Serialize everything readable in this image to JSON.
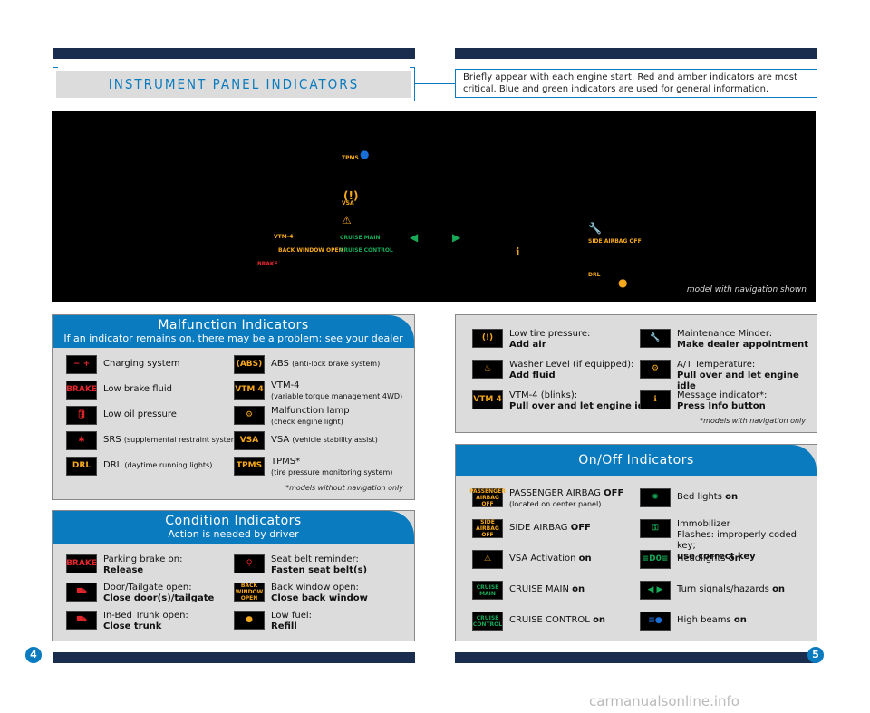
{
  "header": {
    "title": "INSTRUMENT PANEL INDICATORS",
    "note": "Briefly appear with each engine start. Red and amber indicators are most critical. Blue and green indicators are used for general information."
  },
  "dashboard": {
    "caption": "model with navigation shown",
    "labels": [
      "TPMS",
      "VSA",
      "VTM-4",
      "BACK WINDOW OPEN",
      "BRAKE",
      "CRUISE MAIN",
      "CRUISE CONTROL",
      "SIDE AIRBAG OFF",
      "DRL"
    ]
  },
  "colors": {
    "accent": "#0a7bbf",
    "red": "#e3262b",
    "amber": "#f5a81c",
    "green": "#17a957",
    "blue": "#1a6fd6"
  },
  "malfunction": {
    "title": "Malfunction Indicators",
    "subtitle": "If an indicator remains on, there may be a problem; see your dealer",
    "footnote": "*models without navigation only",
    "items": [
      {
        "icon": "battery-icon",
        "glyph": "− +",
        "color": "red",
        "text": "Charging system",
        "note": ""
      },
      {
        "icon": "abs-icon",
        "glyph": "(ABS)",
        "color": "amber",
        "text": "ABS",
        "note": "(anti-lock brake system)"
      },
      {
        "icon": "brake-icon",
        "glyph": "BRAKE",
        "color": "red",
        "text": "Low brake fluid",
        "note": ""
      },
      {
        "icon": "vtm4-icon",
        "glyph": "VTM 4",
        "color": "amber",
        "text": "VTM-4",
        "note": "(variable torque management 4WD)"
      },
      {
        "icon": "oil-can-icon",
        "glyph": "🛢",
        "color": "red",
        "text": "Low oil pressure",
        "note": ""
      },
      {
        "icon": "check-engine-icon",
        "glyph": "⚙",
        "color": "amber",
        "text": "Malfunction lamp",
        "note": "(check engine light)"
      },
      {
        "icon": "srs-airbag-icon",
        "glyph": "✱",
        "color": "red",
        "text": "SRS",
        "note": "(supplemental restraint system)"
      },
      {
        "icon": "vsa-icon",
        "glyph": "VSA",
        "color": "amber",
        "text": "VSA",
        "note": "(vehicle stability assist)"
      },
      {
        "icon": "drl-icon",
        "glyph": "DRL",
        "color": "amber",
        "text": "DRL",
        "note": "(daytime running lights)"
      },
      {
        "icon": "tpms-icon",
        "glyph": "TPMS",
        "color": "amber",
        "text": "TPMS*",
        "note": "(tire pressure monitoring system)"
      }
    ]
  },
  "condition": {
    "title": "Condition Indicators",
    "subtitle": "Action is needed by driver",
    "items": [
      {
        "icon": "parking-brake-icon",
        "glyph": "BRAKE",
        "color": "red",
        "text": "Parking brake on:",
        "action": "Release"
      },
      {
        "icon": "seat-belt-icon",
        "glyph": "⚲",
        "color": "red",
        "text": "Seat belt reminder:",
        "action": "Fasten seat belt(s)"
      },
      {
        "icon": "door-open-icon",
        "glyph": "⛟",
        "color": "red",
        "text": "Door/Tailgate open:",
        "action": "Close door(s)/tailgate"
      },
      {
        "icon": "back-window-icon",
        "glyph": "BACK WINDOW OPEN",
        "color": "amber",
        "text": "Back window open:",
        "action": "Close back window"
      },
      {
        "icon": "trunk-open-icon",
        "glyph": "⛟",
        "color": "red",
        "text": "In-Bed Trunk open:",
        "action": "Close trunk"
      },
      {
        "icon": "low-fuel-icon",
        "glyph": "●",
        "color": "amber",
        "text": "Low fuel:",
        "action": "Refill"
      }
    ]
  },
  "info": {
    "footnote": "*models with navigation only",
    "items": [
      {
        "icon": "tire-pressure-icon",
        "glyph": "(!)",
        "color": "amber",
        "text": "Low tire pressure:",
        "action": "Add air"
      },
      {
        "icon": "wrench-icon",
        "glyph": "🔧",
        "color": "amber",
        "text": "Maintenance Minder:",
        "action": "Make dealer appointment"
      },
      {
        "icon": "washer-icon",
        "glyph": "♨",
        "color": "amber",
        "text": "Washer Level (if equipped):",
        "action": "Add fluid"
      },
      {
        "icon": "at-temperature-icon",
        "glyph": "⚙",
        "color": "amber",
        "text": "A/T Temperature:",
        "action": "Pull over and let engine idle"
      },
      {
        "icon": "vtm4-icon",
        "glyph": "VTM 4",
        "color": "amber",
        "text": "VTM-4 (blinks):",
        "action": "Pull over and let engine idle"
      },
      {
        "icon": "info-icon",
        "glyph": "ℹ",
        "color": "amber",
        "text": "Message indicator*:",
        "action": "Press Info button"
      }
    ]
  },
  "onoff": {
    "title": "On/Off Indicators",
    "items": [
      {
        "icon": "passenger-airbag-off-icon",
        "glyph": "PASSENGER AIRBAG OFF",
        "color": "amber",
        "text": "PASSENGER AIRBAG ",
        "bold": "OFF",
        "sub": "(located on center panel)"
      },
      {
        "icon": "bed-lights-icon",
        "glyph": "✺",
        "color": "green",
        "text": "Bed lights ",
        "bold": "on",
        "sub": ""
      },
      {
        "icon": "side-airbag-off-icon",
        "glyph": "SIDE AIRBAG OFF",
        "color": "amber",
        "text": "SIDE AIRBAG ",
        "bold": "OFF",
        "sub": ""
      },
      {
        "icon": "immobilizer-key-icon",
        "glyph": "⚿",
        "color": "green",
        "text": "Immobilizer",
        "bold": "",
        "sub": "Flashes: improperly coded key;",
        "sub2": "use correct key"
      },
      {
        "icon": "warning-triangle-icon",
        "glyph": "⚠",
        "color": "amber",
        "text": "VSA Activation ",
        "bold": "on",
        "sub": ""
      },
      {
        "icon": "headlights-icon",
        "glyph": "≡D0≡",
        "color": "green",
        "text": "Headlights ",
        "bold": "on",
        "sub": ""
      },
      {
        "icon": "cruise-main-icon",
        "glyph": "CRUISE MAIN",
        "color": "green",
        "text": "CRUISE MAIN ",
        "bold": "on",
        "sub": ""
      },
      {
        "icon": "turn-signals-icon",
        "glyph": "◀ ▶",
        "color": "green",
        "text": "Turn signals/hazards ",
        "bold": "on",
        "sub": ""
      },
      {
        "icon": "cruise-control-icon",
        "glyph": "CRUISE CONTROL",
        "color": "green",
        "text": "CRUISE CONTROL ",
        "bold": "on",
        "sub": ""
      },
      {
        "icon": "high-beams-icon",
        "glyph": "≡●",
        "color": "blue",
        "text": "High beams ",
        "bold": "on",
        "sub": ""
      }
    ]
  },
  "pages": {
    "left": "4",
    "right": "5"
  },
  "watermark": "carmanualsonline.info"
}
